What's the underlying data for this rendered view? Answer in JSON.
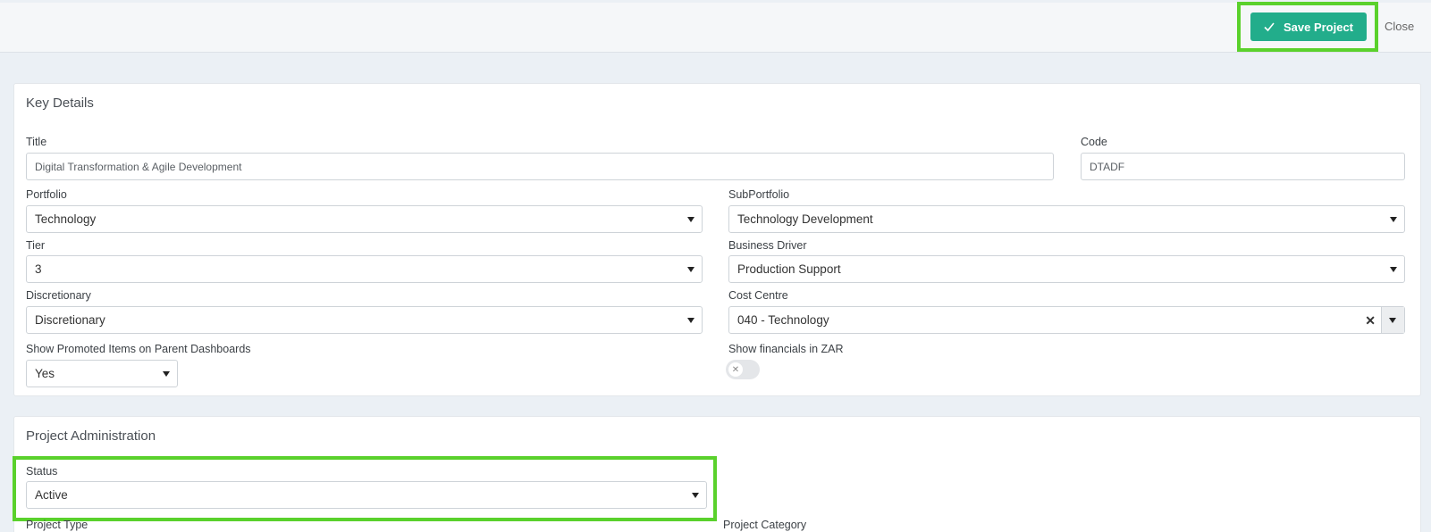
{
  "toolbar": {
    "save_label": "Save Project",
    "close_label": "Close"
  },
  "key_details": {
    "heading": "Key Details",
    "title_label": "Title",
    "title_value": "Digital Transformation & Agile Development",
    "code_label": "Code",
    "code_value": "DTADF",
    "portfolio_label": "Portfolio",
    "portfolio_value": "Technology",
    "subportfolio_label": "SubPortfolio",
    "subportfolio_value": "Technology Development",
    "tier_label": "Tier",
    "tier_value": "3",
    "business_driver_label": "Business Driver",
    "business_driver_value": "Production Support",
    "discretionary_label": "Discretionary",
    "discretionary_value": "Discretionary",
    "cost_centre_label": "Cost Centre",
    "cost_centre_value": "040 - Technology",
    "promoted_label": "Show Promoted Items on Parent Dashboards",
    "promoted_value": "Yes",
    "zar_label": "Show financials in ZAR",
    "zar_enabled": false
  },
  "project_admin": {
    "heading": "Project Administration",
    "status_label": "Status",
    "status_value": "Active",
    "project_type_label": "Project Type",
    "project_category_label": "Project Category"
  },
  "colors": {
    "accent": "#22ad8b",
    "highlight": "#5ad12c",
    "background": "#ebf0f5"
  },
  "icons": {
    "save": "check-icon",
    "clear": "clear-x-icon",
    "toggle_off": "x-icon"
  }
}
